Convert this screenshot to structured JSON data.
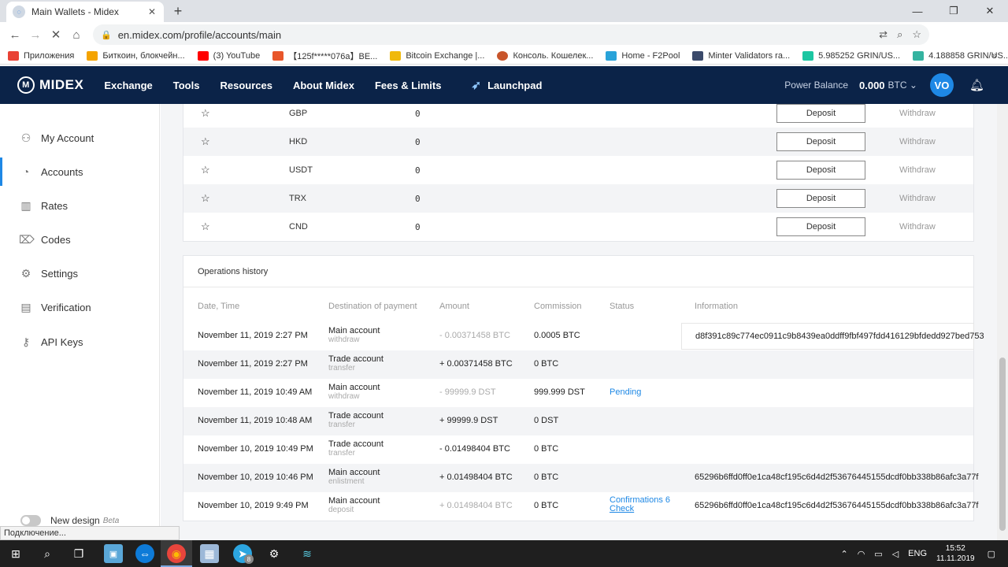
{
  "browser": {
    "tab_title": "Main Wallets - Midex",
    "url": "en.midex.com/profile/accounts/main",
    "bookmarks": [
      {
        "label": "Приложения",
        "color": "#e94235"
      },
      {
        "label": "Биткоин, блокчейн...",
        "color": "#f4a300"
      },
      {
        "label": "(3) YouTube",
        "color": "#ff0000"
      },
      {
        "label": "【125f*****076a】BE...",
        "color": "#e8562a"
      },
      {
        "label": "Bitcoin Exchange |...",
        "color": "#f0b90b"
      },
      {
        "label": "Консоль. Кошелек...",
        "color": "#c8552b"
      },
      {
        "label": "Home - F2Pool",
        "color": "#29a3d9"
      },
      {
        "label": "Minter Validators ra...",
        "color": "#3b4a6b"
      },
      {
        "label": "5.985252 GRIN/US...",
        "color": "#1cc6a2"
      },
      {
        "label": "4.188858 GRIN/US...",
        "color": "#34b3a0"
      }
    ],
    "status_text": "Подключение..."
  },
  "header": {
    "logo": "MIDEX",
    "menu": [
      "Exchange",
      "Tools",
      "Resources",
      "About Midex",
      "Fees & Limits"
    ],
    "launchpad": "Launchpad",
    "power_balance_label": "Power Balance",
    "power_balance_value": "0.000",
    "power_balance_currency": "BTC",
    "avatar": "VO"
  },
  "sidebar": {
    "items": [
      {
        "label": "My Account",
        "icon": "user-icon"
      },
      {
        "label": "Accounts",
        "icon": "pie-icon"
      },
      {
        "label": "Rates",
        "icon": "chart-icon"
      },
      {
        "label": "Codes",
        "icon": "tag-icon"
      },
      {
        "label": "Settings",
        "icon": "gear-icon"
      },
      {
        "label": "Verification",
        "icon": "doc-icon"
      },
      {
        "label": "API Keys",
        "icon": "key-icon"
      }
    ],
    "new_design": "New design",
    "beta": "Beta"
  },
  "currencies": {
    "deposit_label": "Deposit",
    "withdraw_label": "Withdraw",
    "rows": [
      {
        "code": "GBP",
        "balance": "0"
      },
      {
        "code": "HKD",
        "balance": "0"
      },
      {
        "code": "USDT",
        "balance": "0"
      },
      {
        "code": "TRX",
        "balance": "0"
      },
      {
        "code": "CND",
        "balance": "0"
      }
    ]
  },
  "operations": {
    "title": "Operations history",
    "columns": [
      "Date, Time",
      "Destination of payment",
      "Amount",
      "Commission",
      "Status",
      "Information"
    ],
    "rows": [
      {
        "date": "November 11, 2019 2:27 PM",
        "dest": "Main account",
        "dest_sub": "withdraw",
        "amount": "- 0.00371458 BTC",
        "amount_muted": true,
        "commission": "0.0005 BTC",
        "status": "",
        "status2": "",
        "info": "d8f391c89c774ec0911c9b8439ea0ddff9fbf497fdd416129bfdedd927bed753"
      },
      {
        "date": "November 11, 2019 2:27 PM",
        "dest": "Trade account",
        "dest_sub": "transfer",
        "amount": "+ 0.00371458 BTC",
        "amount_muted": false,
        "commission": "0 BTC",
        "status": "",
        "status2": "",
        "info": ""
      },
      {
        "date": "November 11, 2019 10:49 AM",
        "dest": "Main account",
        "dest_sub": "withdraw",
        "amount": "- 99999.9 DST",
        "amount_muted": true,
        "commission": "999.999 DST",
        "status": "Pending",
        "status2": "",
        "info": ""
      },
      {
        "date": "November 11, 2019 10:48 AM",
        "dest": "Trade account",
        "dest_sub": "transfer",
        "amount": "+ 99999.9 DST",
        "amount_muted": false,
        "commission": "0 DST",
        "status": "",
        "status2": "",
        "info": ""
      },
      {
        "date": "November 10, 2019 10:49 PM",
        "dest": "Trade account",
        "dest_sub": "transfer",
        "amount": "- 0.01498404 BTC",
        "amount_muted": false,
        "commission": "0 BTC",
        "status": "",
        "status2": "",
        "info": ""
      },
      {
        "date": "November 10, 2019 10:46 PM",
        "dest": "Main account",
        "dest_sub": "enlistment",
        "amount": "+ 0.01498404 BTC",
        "amount_muted": false,
        "commission": "0 BTC",
        "status": "",
        "status2": "",
        "info": "65296b6ffd0ff0e1ca48cf195c6d4d2f53676445155dcdf0bb338b86afc3a77f"
      },
      {
        "date": "November 10, 2019 9:49 PM",
        "dest": "Main account",
        "dest_sub": "deposit",
        "amount": "+ 0.01498404 BTC",
        "amount_muted": true,
        "commission": "0 BTC",
        "status": "Confirmations 6",
        "status2": "Check",
        "info": "65296b6ffd0ff0e1ca48cf195c6d4d2f53676445155dcdf0bb338b86afc3a77f"
      }
    ]
  },
  "taskbar": {
    "lang": "ENG",
    "time": "15:52",
    "date": "11.11.2019",
    "badge": "8"
  }
}
